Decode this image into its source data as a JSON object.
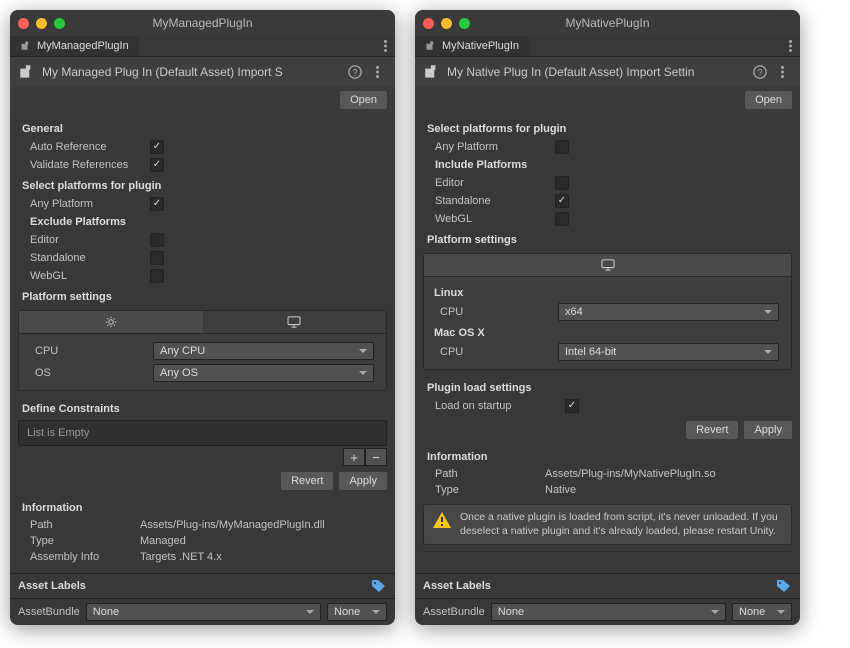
{
  "left": {
    "title": "MyManagedPlugIn",
    "tab": "MyManagedPlugIn",
    "header": "My Managed Plug In (Default Asset) Import S",
    "open": "Open",
    "general": {
      "heading": "General",
      "auto_ref": "Auto Reference",
      "validate_ref": "Validate References"
    },
    "platforms": {
      "heading": "Select platforms for plugin",
      "any": "Any Platform",
      "exclude": "Exclude Platforms",
      "editor": "Editor",
      "standalone": "Standalone",
      "webgl": "WebGL"
    },
    "settings": {
      "heading": "Platform settings",
      "cpu": "CPU",
      "cpu_val": "Any CPU",
      "os": "OS",
      "os_val": "Any OS"
    },
    "constraints": {
      "heading": "Define Constraints",
      "empty": "List is Empty"
    },
    "revert": "Revert",
    "apply": "Apply",
    "info": {
      "heading": "Information",
      "path_l": "Path",
      "path_v": "Assets/Plug-ins/MyManagedPlugIn.dll",
      "type_l": "Type",
      "type_v": "Managed",
      "asm_l": "Assembly Info",
      "asm_v": "Targets .NET 4.x"
    },
    "assetlabels": "Asset Labels",
    "assetbundle": "AssetBundle",
    "none": "None"
  },
  "right": {
    "title": "MyNativePlugIn",
    "tab": "MyNativePlugIn",
    "header": "My Native Plug In (Default Asset) Import Settin",
    "open": "Open",
    "platforms": {
      "heading": "Select platforms for plugin",
      "any": "Any Platform",
      "include": "Include Platforms",
      "editor": "Editor",
      "standalone": "Standalone",
      "webgl": "WebGL"
    },
    "settings": {
      "heading": "Platform settings",
      "linux": "Linux",
      "mac": "Mac OS X",
      "cpu": "CPU",
      "linux_cpu": "x64",
      "mac_cpu": "Intel 64-bit"
    },
    "load": {
      "heading": "Plugin load settings",
      "startup": "Load on startup"
    },
    "revert": "Revert",
    "apply": "Apply",
    "info": {
      "heading": "Information",
      "path_l": "Path",
      "path_v": "Assets/Plug-ins/MyNativePlugIn.so",
      "type_l": "Type",
      "type_v": "Native"
    },
    "warn": "Once a native plugin is loaded from script, it's never unloaded. If you deselect a native plugin and it's already loaded, please restart Unity.",
    "assetlabels": "Asset Labels",
    "assetbundle": "AssetBundle",
    "none": "None"
  }
}
